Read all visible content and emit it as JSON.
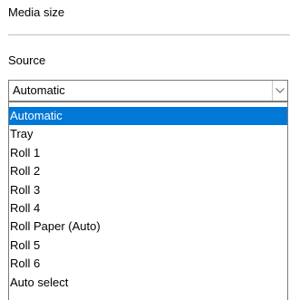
{
  "section": {
    "title": "Media size"
  },
  "source": {
    "label": "Source",
    "selected_value": "Automatic",
    "options": [
      {
        "label": "Automatic",
        "highlighted": true
      },
      {
        "label": "Tray",
        "highlighted": false
      },
      {
        "label": "Roll 1",
        "highlighted": false
      },
      {
        "label": "Roll 2",
        "highlighted": false
      },
      {
        "label": "Roll 3",
        "highlighted": false
      },
      {
        "label": "Roll 4",
        "highlighted": false
      },
      {
        "label": "Roll Paper (Auto)",
        "highlighted": false
      },
      {
        "label": "Roll 5",
        "highlighted": false
      },
      {
        "label": "Roll 6",
        "highlighted": false
      },
      {
        "label": "Auto select",
        "highlighted": false
      }
    ]
  },
  "colors": {
    "highlight_background": "#0078d7",
    "highlight_text": "#ffffff",
    "border": "#7a7a7a",
    "divider": "#bfbfbf"
  },
  "icons": {
    "dropdown_arrow": "chevron-down-icon"
  }
}
